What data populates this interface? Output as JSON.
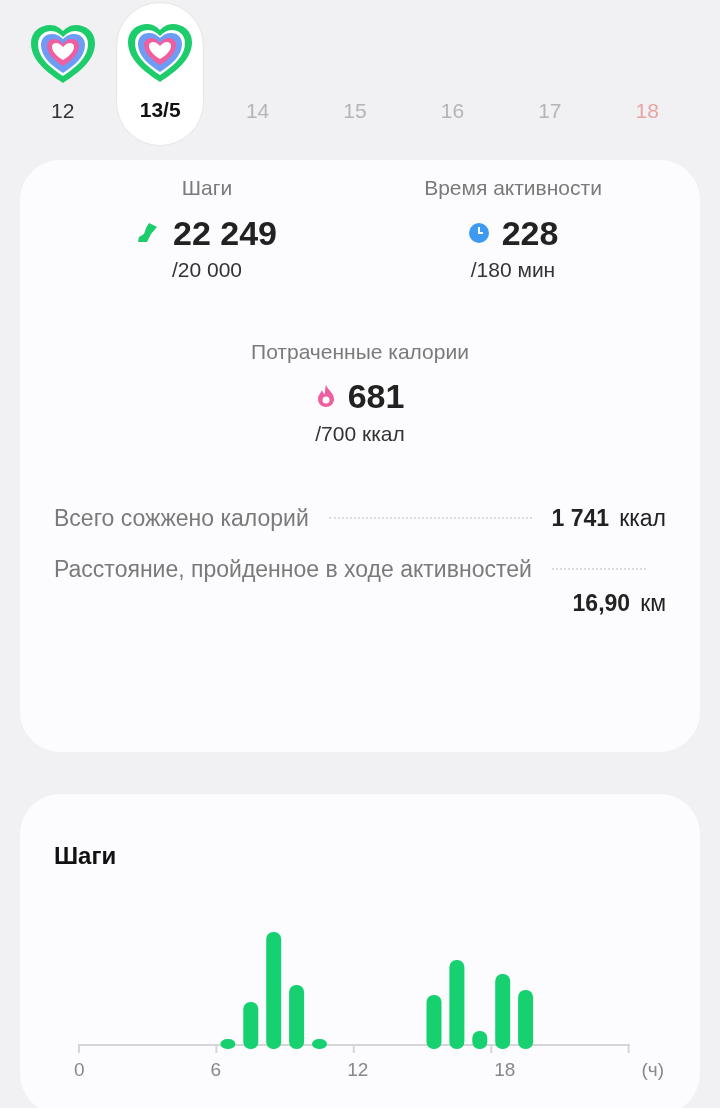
{
  "days": [
    {
      "label": "12",
      "selected": false,
      "rings": true,
      "future": false,
      "weekend": false
    },
    {
      "label": "13/5",
      "selected": true,
      "rings": true,
      "future": false,
      "weekend": false
    },
    {
      "label": "14",
      "selected": false,
      "rings": false,
      "future": true,
      "weekend": false
    },
    {
      "label": "15",
      "selected": false,
      "rings": false,
      "future": true,
      "weekend": false
    },
    {
      "label": "16",
      "selected": false,
      "rings": false,
      "future": true,
      "weekend": false
    },
    {
      "label": "17",
      "selected": false,
      "rings": false,
      "future": true,
      "weekend": false
    },
    {
      "label": "18",
      "selected": false,
      "rings": false,
      "future": true,
      "weekend": true
    }
  ],
  "summary": {
    "goals": [
      {
        "kind": "steps",
        "title": "Шаги",
        "value": "22 249",
        "target": "/20 000"
      },
      {
        "kind": "time",
        "title": "Время активности",
        "value": "228",
        "target": "/180 мин"
      },
      {
        "kind": "calories",
        "title": "Потраченные калории",
        "value": "681",
        "target": "/700 ккал"
      }
    ],
    "details": [
      {
        "label": "Всего сожжено калорий",
        "value": "1 741",
        "unit": "ккал"
      },
      {
        "label": "Расстояние, пройденное в ходе активностей",
        "value": "16,90",
        "unit": "км"
      }
    ]
  },
  "steps_chart": {
    "title": "Шаги",
    "x_labels": [
      "0",
      "6",
      "12",
      "18",
      "(ч)"
    ]
  }
}
